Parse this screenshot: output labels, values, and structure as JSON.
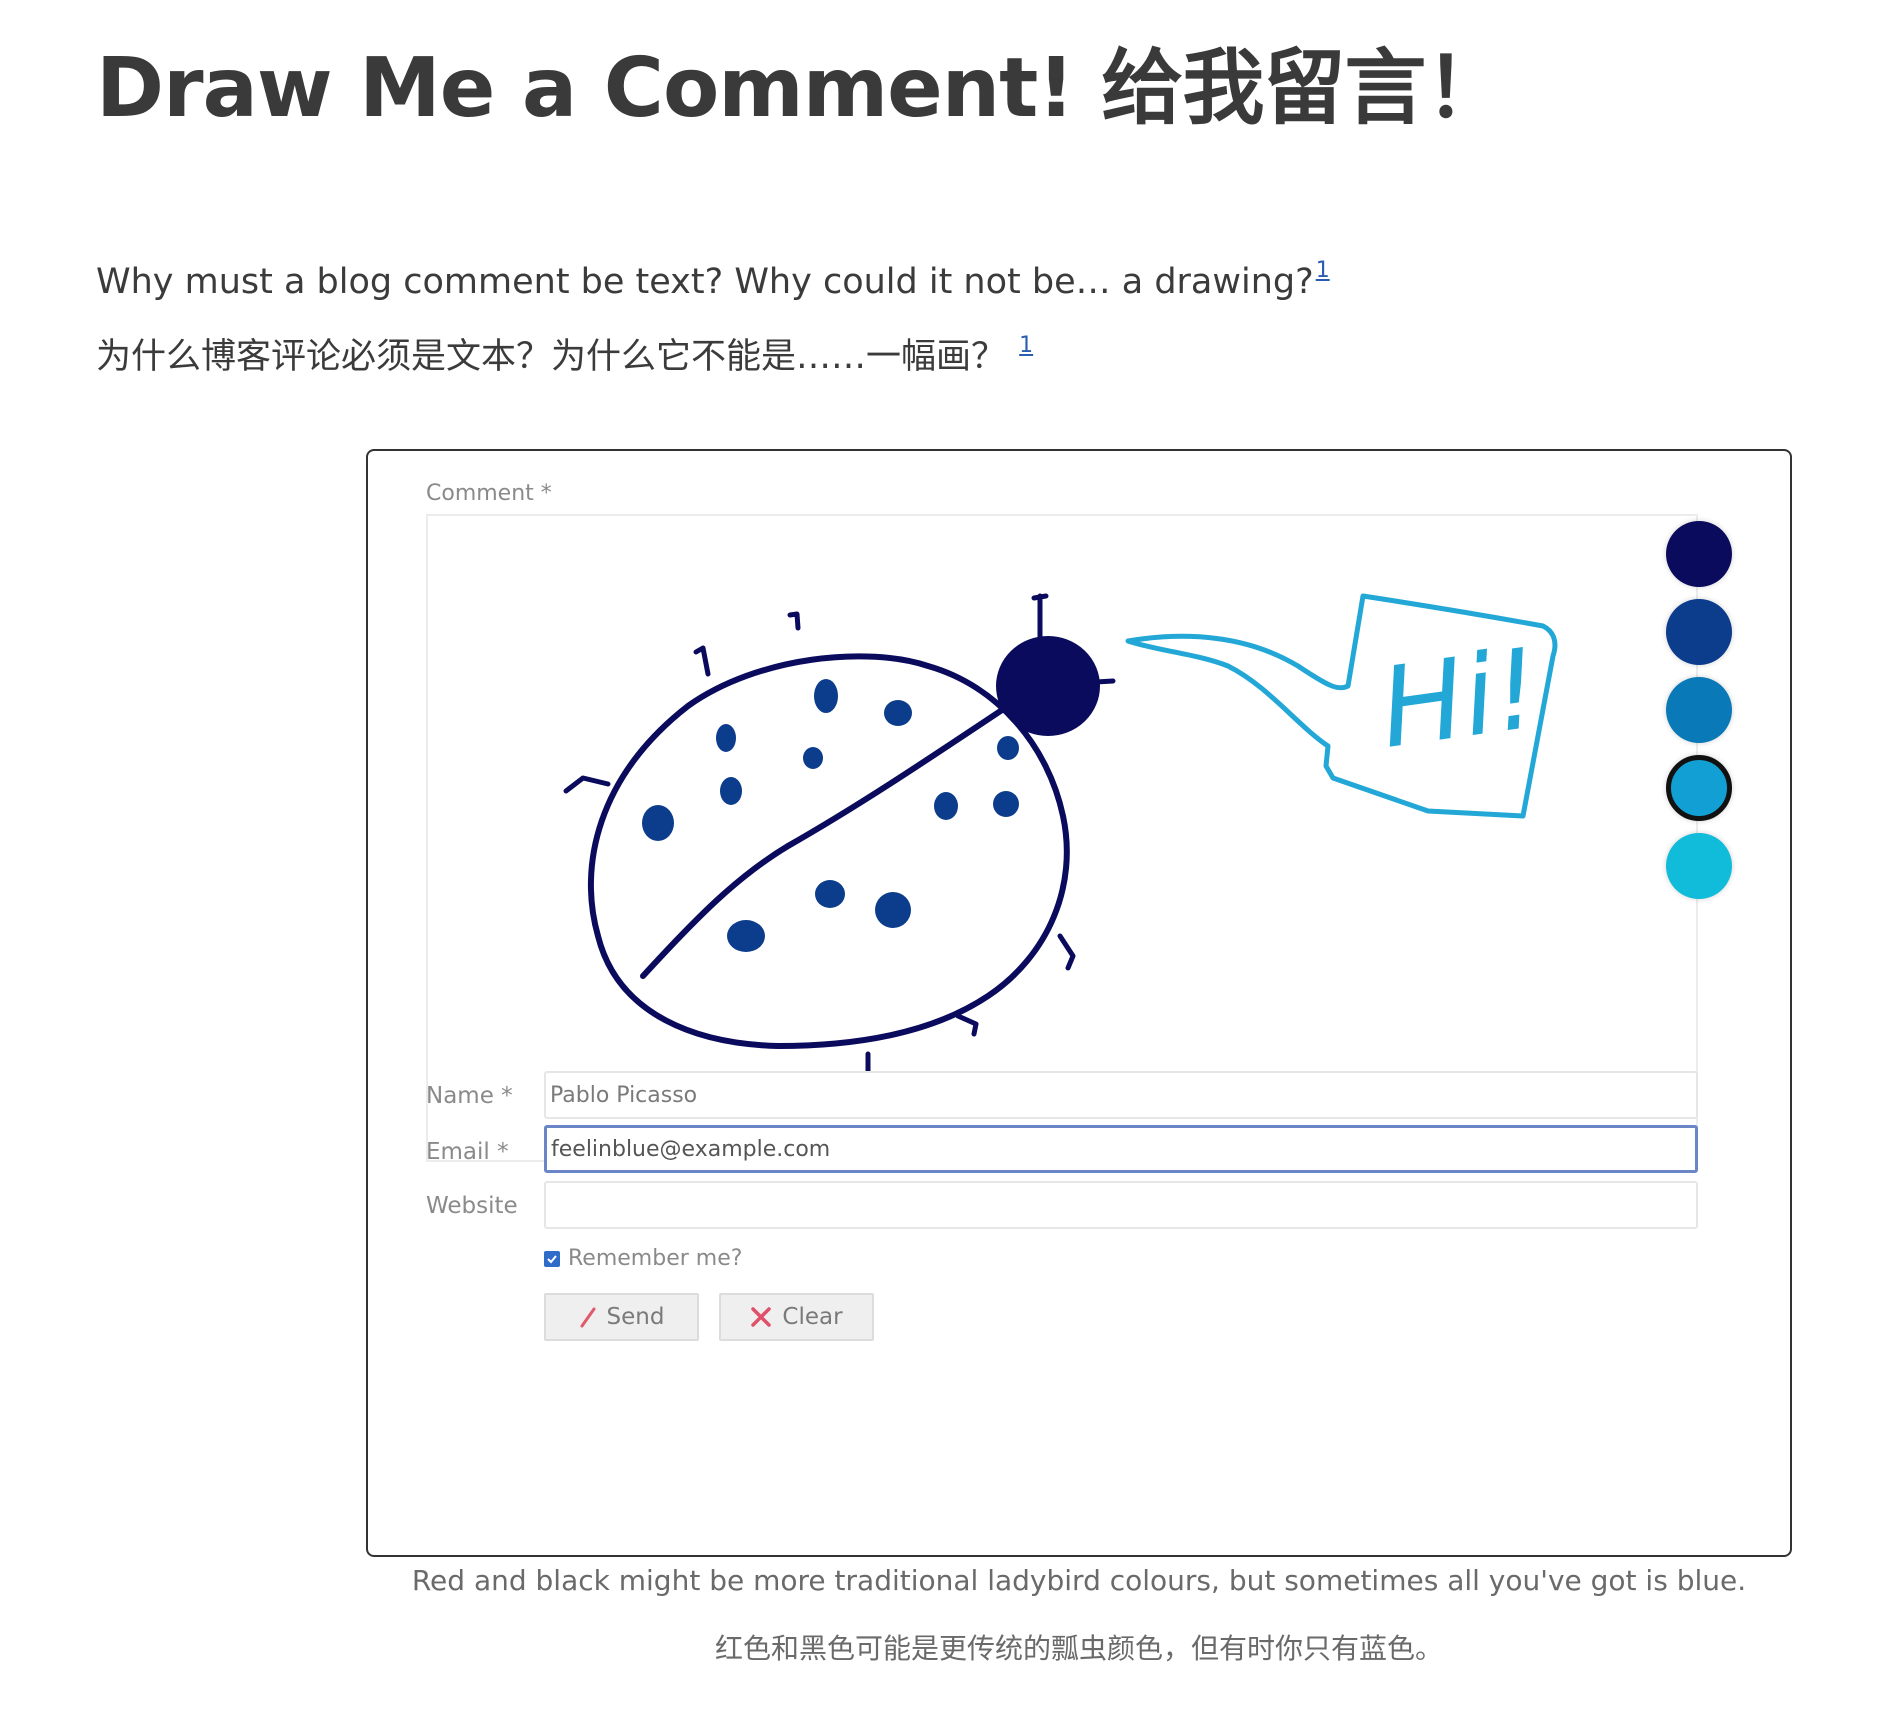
{
  "page": {
    "title": "Draw Me a Comment!  给我留言！",
    "intro_en": "Why must a blog comment be text? Why could it not be… a drawing?",
    "intro_zh": "为什么博客评论必须是文本？为什么它不能是……一幅画？",
    "footnote_ref": "1"
  },
  "form": {
    "comment_label": "Comment *",
    "drawing_text": "Hi!",
    "palette": [
      {
        "color": "#0b0b5e",
        "selected": false
      },
      {
        "color": "#0c3d8c",
        "selected": false
      },
      {
        "color": "#0a79b8",
        "selected": false
      },
      {
        "color": "#12a0d4",
        "selected": true
      },
      {
        "color": "#10bcd9",
        "selected": false
      }
    ],
    "name_label": "Name *",
    "name_value": "Pablo Picasso",
    "email_label": "Email *",
    "email_value": "feelinblue@example.com",
    "website_label": "Website",
    "website_value": "",
    "remember_label": "Remember me?",
    "remember_checked": true,
    "send_label": "Send",
    "clear_label": "Clear"
  },
  "caption": {
    "en": "Red and black might be more traditional ladybird colours, but sometimes all you've got is blue.",
    "zh": "红色和黑色可能是更传统的瓢虫颜色，但有时你只有蓝色。"
  },
  "colors": {
    "ladybird_outline": "#0b0b5e",
    "ladybird_spots": "#0c3d8c",
    "speech_bubble": "#22a7d6",
    "link": "#2a5db0",
    "focus_border": "#6a86c7",
    "send_icon": "#e05a6a",
    "clear_icon": "#e0506a"
  }
}
